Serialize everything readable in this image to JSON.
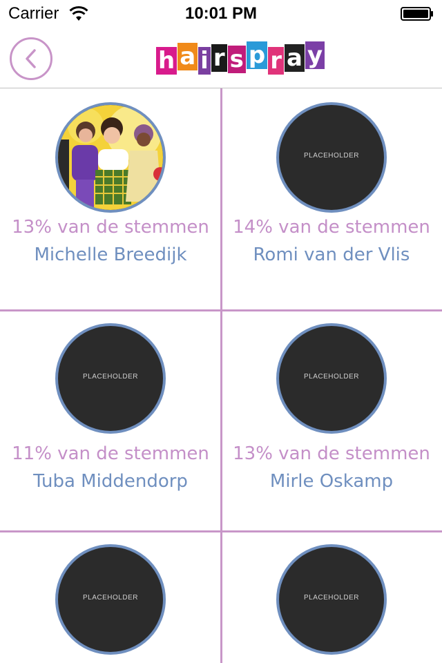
{
  "status_bar": {
    "carrier": "Carrier",
    "time": "10:01 PM"
  },
  "header": {
    "logo_letters": [
      "h",
      "a",
      "i",
      "r",
      "s",
      "p",
      "r",
      "a",
      "y"
    ],
    "logo_colors": [
      "#d81b8c",
      "#f08a1a",
      "#7a3fa0",
      "#1a1a1a",
      "#c01c7a",
      "#2a9ad8",
      "#e0347a",
      "#222222",
      "#7b3fa6"
    ]
  },
  "colors": {
    "accent_pink": "#c896c8",
    "vote_text": "#c48fc8",
    "name_text": "#6f8fbf",
    "avatar_border": "#6f8fbf"
  },
  "placeholder_text": "PLACEHOLDER",
  "candidates": [
    {
      "votes": "13% van de stemmen",
      "name": "Michelle Breedijk",
      "has_photo": true
    },
    {
      "votes": "14% van de stemmen",
      "name": "Romi van der Vlis",
      "has_photo": false
    },
    {
      "votes": "11% van de stemmen",
      "name": "Tuba Middendorp",
      "has_photo": false
    },
    {
      "votes": "13% van de stemmen",
      "name": "Mirle Oskamp",
      "has_photo": false
    },
    {
      "votes": "",
      "name": "",
      "has_photo": false
    },
    {
      "votes": "",
      "name": "",
      "has_photo": false
    }
  ]
}
